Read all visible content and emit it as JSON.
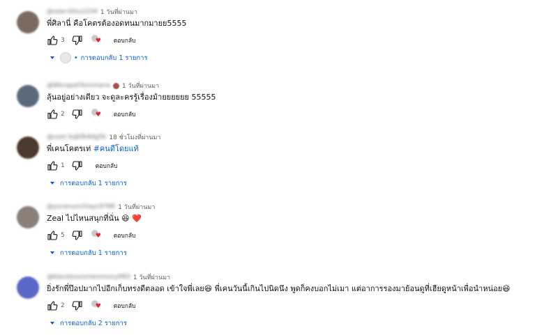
{
  "labels": {
    "reply": "ตอบกลับ",
    "dot": "•"
  },
  "comments": [
    {
      "avatar_color": "#7a6b5f",
      "handle": "@user-blsu1234",
      "handle_emoji": false,
      "time": "1 วันที่ผ่านมา",
      "text": "พี่ศิลานี่ คือโคตรต้องอดทนมากมายย5555",
      "likes": "3",
      "creator_heart": true,
      "replies_label": "การตอบกลับ 1 รายการ",
      "reply_avatar": true
    },
    {
      "avatar_color": "#5b6a7a",
      "handle": "@WorapatYommana",
      "handle_emoji": true,
      "time": "1 วันที่ผ่านมา",
      "text": "ลุ้นอยู่อย่างเดียว จะดูละครรู้เรื่องม้ายยยยยย 55555",
      "likes": "2",
      "creator_heart": true,
      "replies_label": "",
      "reply_avatar": false
    },
    {
      "avatar_color": "#4a3a30",
      "handle": "@user-bqbfb4dg5k",
      "handle_emoji": false,
      "time": "18 ชั่วโมงที่ผ่านมา",
      "text_main": "พี่เคนโคตรเท่ ",
      "hashtag": "#คนดีโดยแท้",
      "likes": "1",
      "creator_heart": false,
      "replies_label": "การตอบกลับ 1 รายการ",
      "reply_avatar": false
    },
    {
      "avatar_color": "#8b7f78",
      "handle": "@yuranunchiayc9786",
      "handle_emoji": false,
      "time": "1 วันที่ผ่านมา",
      "text": "Zeal ไปไหนสนุกที่นั่น 😆 ❤️",
      "likes": "5",
      "creator_heart": true,
      "replies_label": "การตอบกลับ 1 รายการ",
      "reply_avatar": false
    },
    {
      "avatar_color": "#5b67c9",
      "handle": "@blackboxismemmory993",
      "handle_emoji": false,
      "time": "1 วันที่ผ่านมา",
      "text": "ยิ่งรักพี่ป๊อปมากไปอีกเก็บทรงดีตลอด เข้าใจพี่เลย😆 พี่เคนวันนี้เกินไปนิดนึง พูดก็คงบอกไม่เมา แต่อาการรองมาย้อนดูที่เฮียดูหน้าเพื่อนำหน่อย😆",
      "likes": "2",
      "creator_heart": true,
      "replies_label": "การตอบกลับ 2 รายการ",
      "reply_avatar": false
    }
  ]
}
